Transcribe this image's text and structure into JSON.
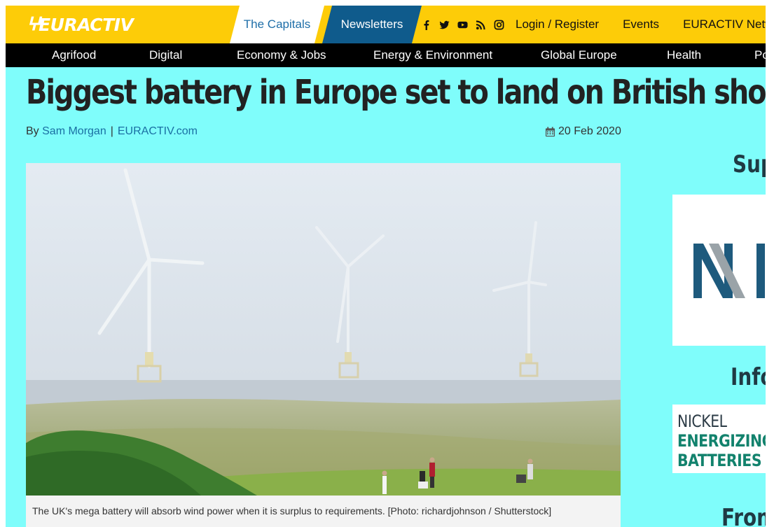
{
  "brand": {
    "logo_text": "EURACTIV"
  },
  "topbar": {
    "tab_capitals": "The Capitals",
    "tab_newsletters": "Newsletters",
    "socials": [
      "facebook-icon",
      "twitter-icon",
      "youtube-icon",
      "rss-icon",
      "instagram-icon"
    ],
    "links": [
      "Login / Register",
      "Events",
      "EURACTIV Network"
    ]
  },
  "nav": {
    "items": [
      "Agrifood",
      "Digital",
      "Economy & Jobs",
      "Energy & Environment",
      "Global Europe",
      "Health",
      "Politics"
    ]
  },
  "article": {
    "headline": "Biggest battery in Europe set to land on British shores",
    "byline_prefix": "By",
    "author": "Sam Morgan",
    "separator": "|",
    "source": "EURACTIV.com",
    "date": "20 Feb 2020",
    "caption": "The UK's mega battery will absorb wind power when it is surplus to requirements. [Photo: richardjohnson / Shutterstock]"
  },
  "sidebar": {
    "heading_support": "Support",
    "heading_info": "Info",
    "heading_from": "From",
    "nickel_line1": "NICKEL",
    "nickel_line2": "ENERGIZING",
    "nickel_line3": "BATTERIES"
  },
  "colors": {
    "topbar_bg": "#fdcc08",
    "navbar_bg": "#000000",
    "page_bg": "#7ffdfb",
    "newsletters_bg": "#0f5b8c",
    "link_blue": "#1a6fa3",
    "nickel_green": "#12826d"
  }
}
